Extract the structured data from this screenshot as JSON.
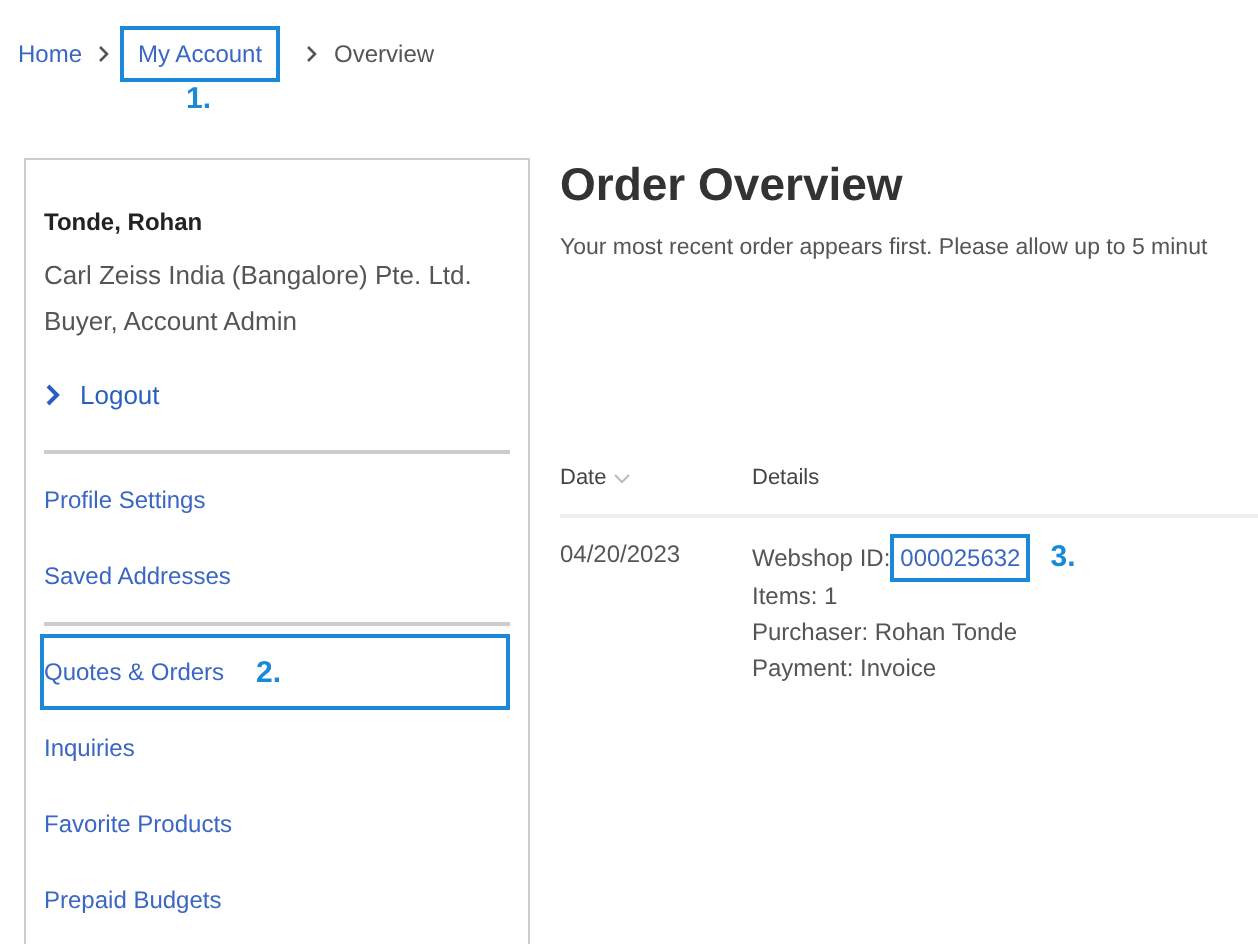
{
  "breadcrumb": [
    {
      "label": "Home",
      "kind": "link",
      "highlighted": false
    },
    {
      "label": "My Account",
      "kind": "link",
      "highlighted": true,
      "callout": "1."
    },
    {
      "label": "Overview",
      "kind": "current"
    }
  ],
  "sidebar": {
    "user_name": "Tonde, Rohan",
    "company": "Carl Zeiss India (Bangalore) Pte. Ltd.",
    "role": "Buyer, Account Admin",
    "logout": "Logout",
    "groups": [
      [
        {
          "label": "Profile Settings",
          "highlighted": false
        },
        {
          "label": "Saved Addresses",
          "highlighted": false
        }
      ],
      [
        {
          "label": "Quotes & Orders",
          "highlighted": true,
          "callout": "2."
        },
        {
          "label": "Inquiries",
          "highlighted": false
        },
        {
          "label": "Favorite Products",
          "highlighted": false
        },
        {
          "label": "Prepaid Budgets",
          "highlighted": false
        }
      ]
    ]
  },
  "main": {
    "title": "Order Overview",
    "subtitle": "Your most recent order appears first. Please allow up to 5 minut",
    "table": {
      "columns": [
        {
          "label": "Date",
          "sortable": true
        },
        {
          "label": "Details",
          "sortable": false
        }
      ],
      "rows": [
        {
          "date": "04/20/2023",
          "id_label": "Webshop ID:",
          "id": "000025632",
          "id_highlighted": true,
          "callout": "3.",
          "lines": [
            "Items: 1",
            "Purchaser: Rohan Tonde",
            "Payment: Invoice"
          ]
        }
      ]
    }
  }
}
